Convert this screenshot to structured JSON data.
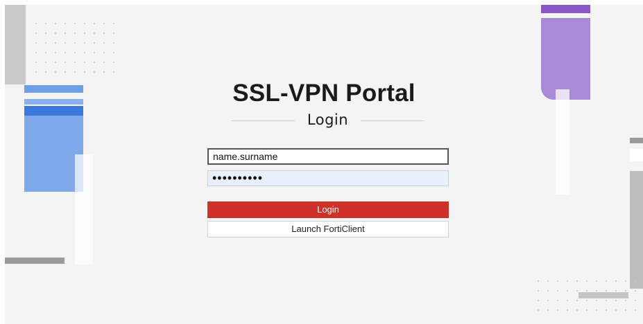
{
  "portal": {
    "title": "SSL-VPN Portal",
    "subtitle": "Login"
  },
  "form": {
    "username_value": "name.surname",
    "password_value": "••••••••••"
  },
  "buttons": {
    "login_label": "Login",
    "forticlient_label": "Launch FortiClient"
  },
  "colors": {
    "background": "#f4f4f4",
    "login_button": "#cd3129",
    "blue_accent": "#3b78dc",
    "purple_accent": "#8a55c4"
  }
}
